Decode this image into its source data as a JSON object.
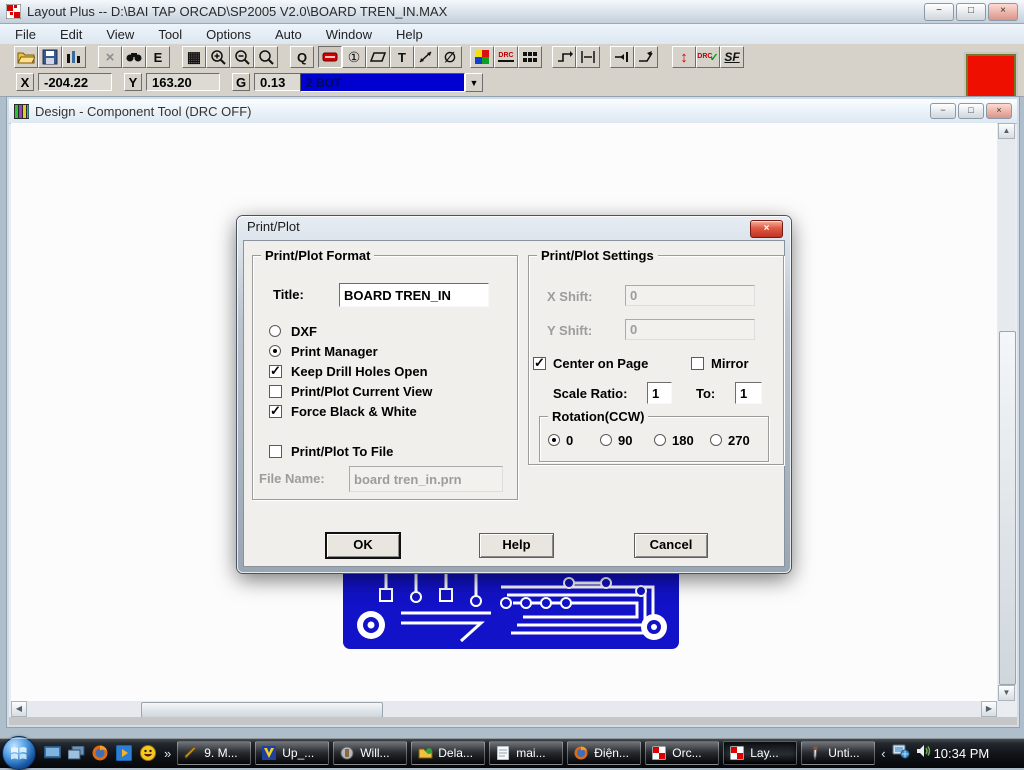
{
  "window": {
    "title": "Layout Plus -- D:\\BAI TAP ORCAD\\SP2005 V2.0\\BOARD TREN_IN.MAX"
  },
  "window_controls": {
    "minimize": "−",
    "maximize": "□",
    "close": "×"
  },
  "menu": {
    "items": [
      "File",
      "Edit",
      "View",
      "Tool",
      "Options",
      "Auto",
      "Window",
      "Help"
    ]
  },
  "toolbar": {
    "glyphs": {
      "delete": "×",
      "edit": "E",
      "grid": "▦",
      "query": "Q",
      "pin": "①",
      "text": "T",
      "noconnect": "∅",
      "drc": "DRC",
      "drc_check": "DRC",
      "check": "✓",
      "shove": "SF",
      "error": "↕",
      "arrow": "▼"
    }
  },
  "coords": {
    "x_label": "X",
    "x_value": "-204.22",
    "y_label": "Y",
    "y_value": "163.20",
    "g_label": "G",
    "g_value": "0.13",
    "layer_selected": "2 BOT"
  },
  "child_window": {
    "title": "Design - Component Tool (DRC OFF)"
  },
  "dialog": {
    "title": "Print/Plot",
    "format": {
      "legend": "Print/Plot Format",
      "title_label": "Title:",
      "title_value": "BOARD TREN_IN",
      "radio_dxf": "DXF",
      "radio_print_manager": "Print Manager",
      "chk_drill": "Keep Drill Holes Open",
      "chk_current_view": "Print/Plot Current View",
      "chk_bw": "Force Black & White",
      "chk_to_file": "Print/Plot To File",
      "file_name_label": "File Name:",
      "file_name_value": "board tren_in.prn"
    },
    "settings": {
      "legend": "Print/Plot Settings",
      "x_shift_label": "X Shift:",
      "x_shift_value": "0",
      "y_shift_label": "Y Shift:",
      "y_shift_value": "0",
      "chk_center": "Center on Page",
      "chk_mirror": "Mirror",
      "scale_label": "Scale Ratio:",
      "scale_value": "1",
      "to_label": "To:",
      "to_value": "1",
      "rotation_legend": "Rotation(CCW)",
      "rot_0": "0",
      "rot_90": "90",
      "rot_180": "180",
      "rot_270": "270"
    },
    "buttons": {
      "ok": "OK",
      "help": "Help",
      "cancel": "Cancel"
    }
  },
  "taskbar": {
    "overflow_more": "»",
    "overflow_less": "‹",
    "tasks": [
      "9. M...",
      "Up_...",
      "Will...",
      "Dela...",
      "mai...",
      "Điện...",
      "Orc...",
      "Lay...",
      "Unti..."
    ],
    "clock": "10:34 PM"
  },
  "colors": {
    "layer_blue": "#0000d0",
    "pcb_blue": "#1212c8",
    "drc_red": "#ee0f00"
  }
}
